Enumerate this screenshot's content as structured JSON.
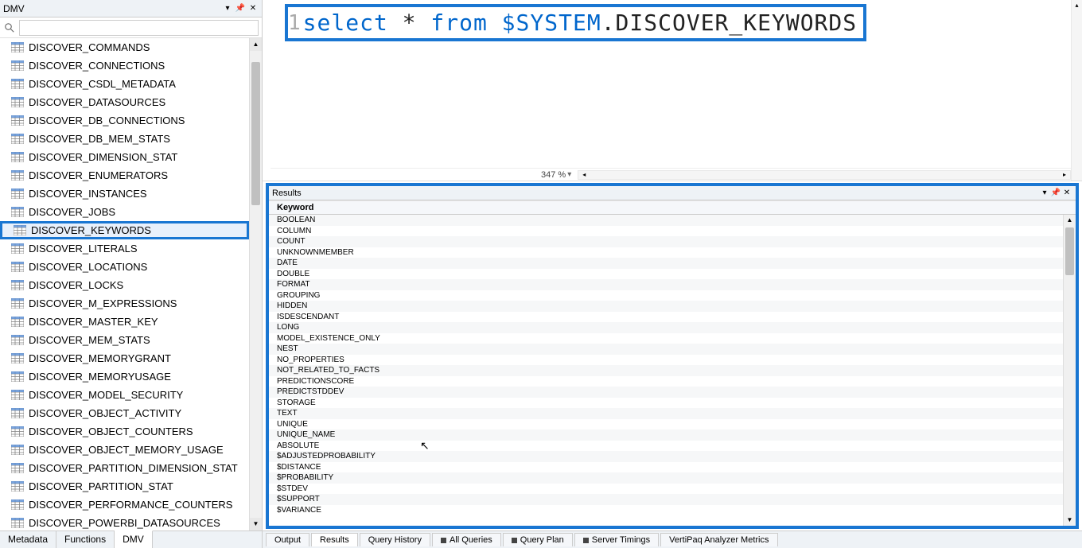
{
  "leftPanel": {
    "title": "DMV",
    "searchPlaceholder": "",
    "items": [
      "DISCOVER_COMMANDS",
      "DISCOVER_CONNECTIONS",
      "DISCOVER_CSDL_METADATA",
      "DISCOVER_DATASOURCES",
      "DISCOVER_DB_CONNECTIONS",
      "DISCOVER_DB_MEM_STATS",
      "DISCOVER_DIMENSION_STAT",
      "DISCOVER_ENUMERATORS",
      "DISCOVER_INSTANCES",
      "DISCOVER_JOBS",
      "DISCOVER_KEYWORDS",
      "DISCOVER_LITERALS",
      "DISCOVER_LOCATIONS",
      "DISCOVER_LOCKS",
      "DISCOVER_M_EXPRESSIONS",
      "DISCOVER_MASTER_KEY",
      "DISCOVER_MEM_STATS",
      "DISCOVER_MEMORYGRANT",
      "DISCOVER_MEMORYUSAGE",
      "DISCOVER_MODEL_SECURITY",
      "DISCOVER_OBJECT_ACTIVITY",
      "DISCOVER_OBJECT_COUNTERS",
      "DISCOVER_OBJECT_MEMORY_USAGE",
      "DISCOVER_PARTITION_DIMENSION_STAT",
      "DISCOVER_PARTITION_STAT",
      "DISCOVER_PERFORMANCE_COUNTERS",
      "DISCOVER_POWERBI_DATASOURCES"
    ],
    "selectedIndex": 10,
    "tabs": [
      "Metadata",
      "Functions",
      "DMV"
    ],
    "activeTab": 2
  },
  "editor": {
    "lineNumber": "1",
    "tokens": [
      {
        "t": "select",
        "c": "blue"
      },
      {
        "t": " * ",
        "c": "black"
      },
      {
        "t": "from",
        "c": "blue"
      },
      {
        "t": " $SYSTEM",
        "c": "blue"
      },
      {
        "t": ".DISCOVER_KEYWORDS",
        "c": "black"
      }
    ],
    "zoom": "347 %"
  },
  "results": {
    "title": "Results",
    "columnHeader": "Keyword",
    "rows": [
      "BOOLEAN",
      "COLUMN",
      "COUNT",
      "UNKNOWNMEMBER",
      "DATE",
      "DOUBLE",
      "FORMAT",
      "GROUPING",
      "HIDDEN",
      "ISDESCENDANT",
      "LONG",
      "MODEL_EXISTENCE_ONLY",
      "NEST",
      "NO_PROPERTIES",
      "NOT_RELATED_TO_FACTS",
      "PREDICTIONSCORE",
      "PREDICTSTDDEV",
      "STORAGE",
      "TEXT",
      "UNIQUE",
      "UNIQUE_NAME",
      "ABSOLUTE",
      "$ADJUSTEDPROBABILITY",
      "$DISTANCE",
      "$PROBABILITY",
      "$STDEV",
      "$SUPPORT",
      "$VARIANCE"
    ]
  },
  "bottomTabs": {
    "items": [
      "Output",
      "Results",
      "Query History",
      "All Queries",
      "Query Plan",
      "Server Timings",
      "VertiPaq Analyzer Metrics"
    ],
    "activeIndex": 1,
    "stopIcons": {
      "3": true,
      "4": true,
      "5": true
    }
  }
}
